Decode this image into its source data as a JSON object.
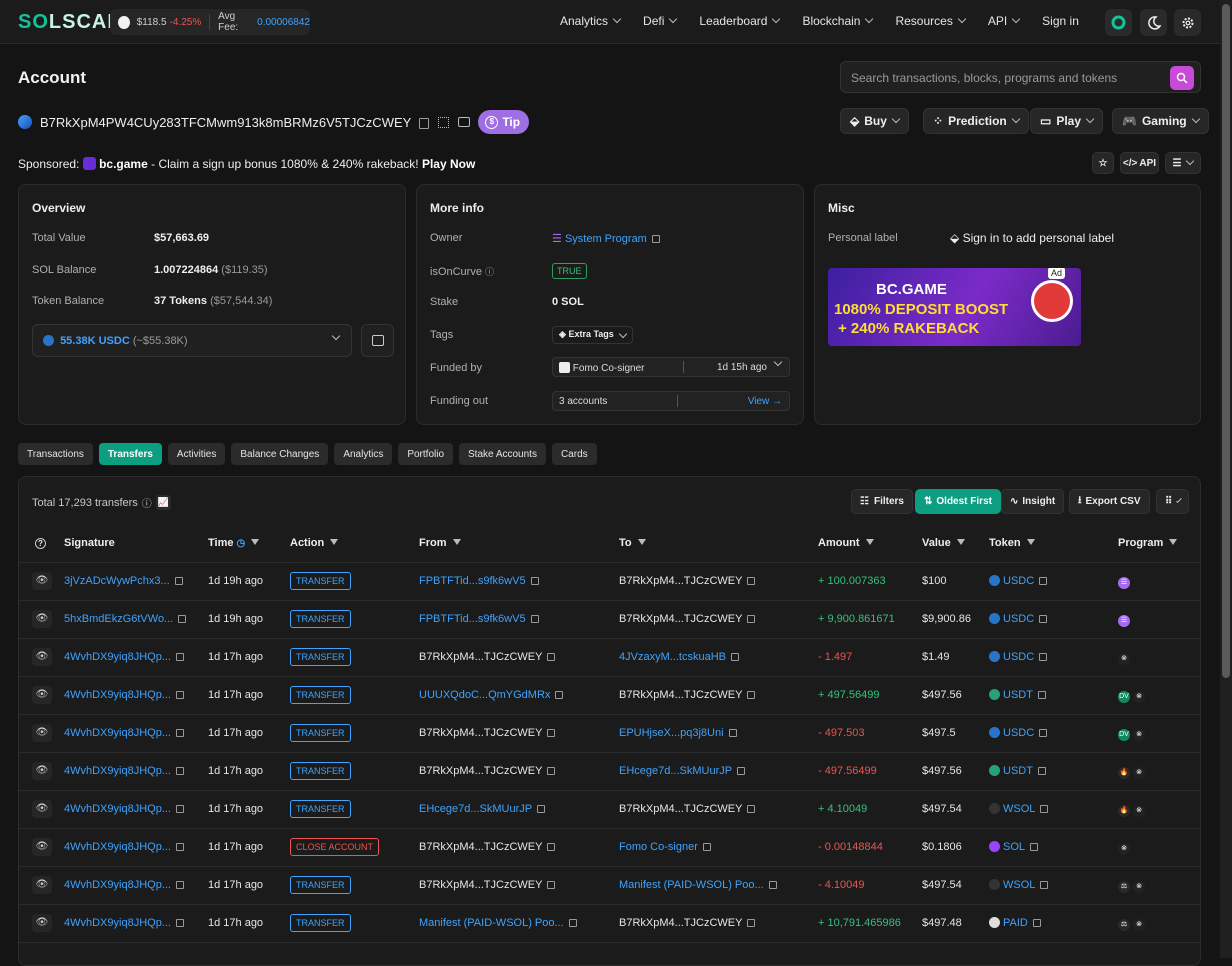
{
  "brand": {
    "logo_a": "S",
    "logo_b": "O",
    "logo_c": "LSCAN"
  },
  "ticker": {
    "sol_price": "$118.5",
    "sol_change": "-4.25%",
    "fee_label": "Avg Fee:",
    "fee_value": "0.00006842"
  },
  "nav": [
    "Analytics",
    "Defi",
    "Leaderboard",
    "Blockchain",
    "Resources",
    "API",
    "Sign in"
  ],
  "page": {
    "title": "Account",
    "search_placeholder": "Search transactions, blocks, programs and tokens",
    "address": "B7RkXpM4PW4CUy283TFCMwm913k8mBRMz6V5TJCzCWEY",
    "tip": "Tip"
  },
  "quick_buttons": [
    "Buy",
    "Prediction",
    "Play",
    "Gaming"
  ],
  "sponsor": {
    "prefix": "Sponsored:",
    "name": "bc.game",
    "text": "- Claim a sign up bonus 1080% & 240% rakeback!",
    "cta": "Play Now"
  },
  "tools": {
    "api": "API"
  },
  "overview": {
    "title": "Overview",
    "total_value_label": "Total Value",
    "total_value": "$57,663.69",
    "sol_label": "SOL Balance",
    "sol": "1.007224864",
    "sol_usd": "($119.35)",
    "token_label": "Token Balance",
    "tokens": "37 Tokens",
    "tokens_usd": "($57,544.34)",
    "selected_token": "55.38K USDC",
    "selected_token_usd": "(~$55.38K)"
  },
  "more_info": {
    "title": "More info",
    "owner_label": "Owner",
    "owner": "System Program",
    "curve_label": "isOnCurve",
    "curve": "TRUE",
    "stake_label": "Stake",
    "stake": "0 SOL",
    "tags_label": "Tags",
    "tags": "Extra Tags",
    "funded_label": "Funded by",
    "funded_by": "Fomo Co-signer",
    "funded_time": "1d 15h ago",
    "funding_out_label": "Funding out",
    "funding_out": "3 accounts",
    "view": "View"
  },
  "misc": {
    "title": "Misc",
    "label_key": "Personal label",
    "label_action": "Sign in to add personal label",
    "ad_tag": "Ad",
    "ad_line1": "BC.GAME",
    "ad_line2": "1080% DEPOSIT BOOST",
    "ad_line3": "+ 240% RAKEBACK"
  },
  "tabs": [
    "Transactions",
    "Transfers",
    "Activities",
    "Balance Changes",
    "Analytics",
    "Portfolio",
    "Stake Accounts",
    "Cards"
  ],
  "transfers": {
    "total": "Total 17,293 transfers",
    "filters": "Filters",
    "sort": "Oldest First",
    "insight": "Insight",
    "export": "Export CSV",
    "columns": [
      "Signature",
      "Time",
      "Action",
      "From",
      "To",
      "Amount",
      "Value",
      "Token",
      "Program"
    ],
    "rows": [
      {
        "sig": "3jVzADcWywPchx3...",
        "time": "1d 19h ago",
        "action": "TRANSFER",
        "from": "FPBTFTid...s9fk6wV5",
        "from_link": true,
        "to": "B7RkXpM4...TJCzCWEY",
        "to_link": false,
        "amount": "+ 100.007363",
        "value": "$100",
        "token": "USDC"
      },
      {
        "sig": "5hxBmdEkzG6tVWo...",
        "time": "1d 19h ago",
        "action": "TRANSFER",
        "from": "FPBTFTid...s9fk6wV5",
        "from_link": true,
        "to": "B7RkXpM4...TJCzCWEY",
        "to_link": false,
        "amount": "+ 9,900.861671",
        "value": "$9,900.86",
        "token": "USDC"
      },
      {
        "sig": "4WvhDX9yiq8JHQp...",
        "time": "1d 17h ago",
        "action": "TRANSFER",
        "from": "B7RkXpM4...TJCzCWEY",
        "from_link": false,
        "to": "4JVzaxyM...tcskuaHB",
        "to_link": true,
        "amount": "- 1.497",
        "value": "$1.49",
        "token": "USDC"
      },
      {
        "sig": "4WvhDX9yiq8JHQp...",
        "time": "1d 17h ago",
        "action": "TRANSFER",
        "from": "UUUXQdoC...QmYGdMRx",
        "from_link": true,
        "to": "B7RkXpM4...TJCzCWEY",
        "to_link": false,
        "amount": "+ 497.56499",
        "value": "$497.56",
        "token": "USDT"
      },
      {
        "sig": "4WvhDX9yiq8JHQp...",
        "time": "1d 17h ago",
        "action": "TRANSFER",
        "from": "B7RkXpM4...TJCzCWEY",
        "from_link": false,
        "to": "EPUHjseX...pq3j8Uni",
        "to_link": true,
        "amount": "- 497.503",
        "value": "$497.5",
        "token": "USDC"
      },
      {
        "sig": "4WvhDX9yiq8JHQp...",
        "time": "1d 17h ago",
        "action": "TRANSFER",
        "from": "B7RkXpM4...TJCzCWEY",
        "from_link": false,
        "to": "EHcege7d...SkMUurJP",
        "to_link": true,
        "amount": "- 497.56499",
        "value": "$497.56",
        "token": "USDT"
      },
      {
        "sig": "4WvhDX9yiq8JHQp...",
        "time": "1d 17h ago",
        "action": "TRANSFER",
        "from": "EHcege7d...SkMUurJP",
        "from_link": true,
        "to": "B7RkXpM4...TJCzCWEY",
        "to_link": false,
        "amount": "+ 4.10049",
        "value": "$497.54",
        "token": "WSOL"
      },
      {
        "sig": "4WvhDX9yiq8JHQp...",
        "time": "1d 17h ago",
        "action": "CLOSE ACCOUNT",
        "from": "B7RkXpM4...TJCzCWEY",
        "from_link": false,
        "to": "Fomo Co-signer",
        "to_link": true,
        "amount": "- 0.00148844",
        "value": "$0.1806",
        "token": "SOL"
      },
      {
        "sig": "4WvhDX9yiq8JHQp...",
        "time": "1d 17h ago",
        "action": "TRANSFER",
        "from": "B7RkXpM4...TJCzCWEY",
        "from_link": false,
        "to": "Manifest (PAID-WSOL) Poo...",
        "to_link": true,
        "amount": "- 4.10049",
        "value": "$497.54",
        "token": "WSOL"
      },
      {
        "sig": "4WvhDX9yiq8JHQp...",
        "time": "1d 17h ago",
        "action": "TRANSFER",
        "from": "Manifest (PAID-WSOL) Poo...",
        "from_link": true,
        "to": "B7RkXpM4...TJCzCWEY",
        "to_link": false,
        "amount": "+ 10,791.465986",
        "value": "$497.48",
        "token": "PAID"
      }
    ]
  }
}
